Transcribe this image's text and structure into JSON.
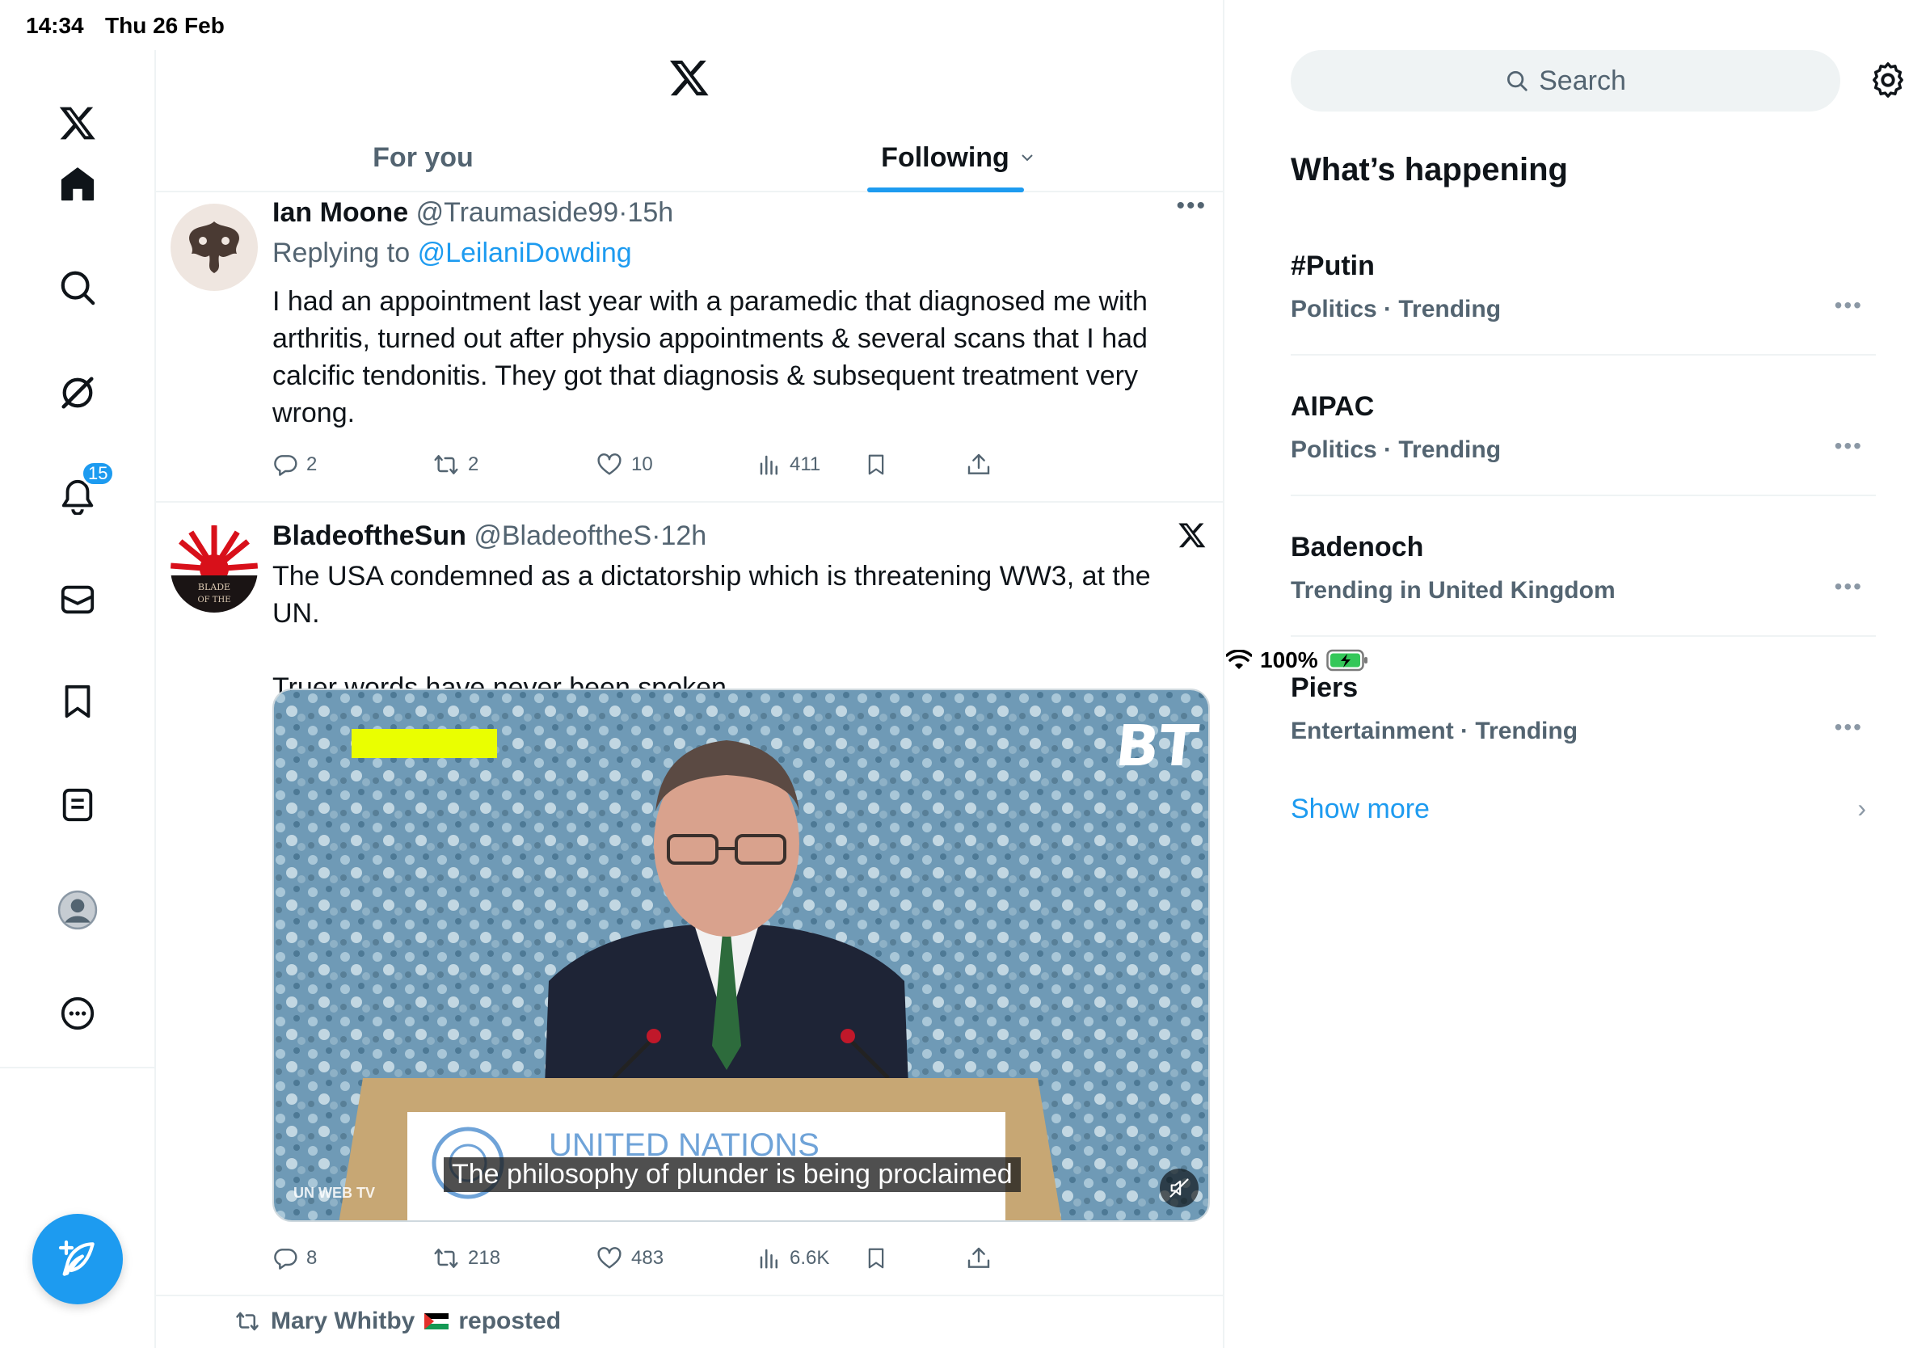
{
  "status_bar": {
    "time": "14:34",
    "date": "Thu 26 Feb",
    "battery": "100%"
  },
  "nav": {
    "notifications_badge": "15"
  },
  "tabs": {
    "for_you": "For you",
    "following": "Following"
  },
  "tweets": [
    {
      "name": "Ian Moone",
      "handle": "@Traumaside99",
      "time": "15h",
      "replying_label": "Replying to",
      "replying_to": "@LeilaniDowding",
      "text": "I had an appointment last year with a paramedic that diagnosed me with arthritis, turned out after physio appointments & several scans that I had calcific tendonitis. They got that diagnosis & subsequent treatment very wrong.",
      "replies": "2",
      "reposts": "2",
      "likes": "10",
      "views": "411"
    },
    {
      "name": "BladeoftheSun",
      "handle": "@BladeoftheS",
      "time": "12h",
      "text": "The USA condemned as a dictatorship which is threatening WW3, at the UN.\n\nTruer words have never been spoken.",
      "media_caption": "The philosophy of plunder is being proclaimed",
      "media_source": "UN WEB TV",
      "media_podium_text": "UNITED NATIONS",
      "media_logo": "BT",
      "replies": "8",
      "reposts": "218",
      "likes": "483",
      "views": "6.6K"
    }
  ],
  "repost_notice": {
    "name": "Mary Whitby",
    "suffix": "reposted"
  },
  "sidebar": {
    "search_placeholder": "Search",
    "heading": "What’s happening",
    "trends": [
      {
        "name": "#Putin",
        "context": "Politics · Trending"
      },
      {
        "name": "AIPAC",
        "context": "Politics · Trending"
      },
      {
        "name": "Badenoch",
        "context": "Trending in United Kingdom"
      },
      {
        "name": "Piers",
        "context": "Entertainment · Trending"
      }
    ],
    "show_more": "Show more"
  },
  "colors": {
    "accent": "#1d9bf0",
    "text": "#0f1419",
    "muted": "#536471",
    "divider": "#eff3f4"
  }
}
